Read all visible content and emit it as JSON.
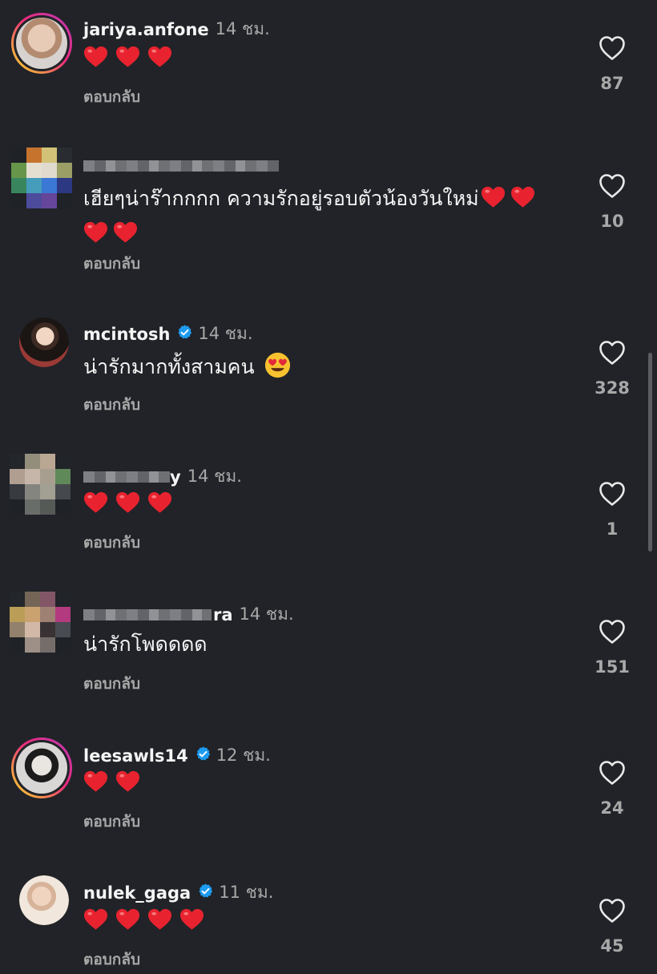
{
  "comments": [
    {
      "username": "jariya.anfone",
      "time": "14 ชม.",
      "text": "",
      "hearts": 3,
      "reply": "ตอบกลับ",
      "likes": "87",
      "verified": false
    },
    {
      "username": "",
      "time": "",
      "text": "เฮียๆน่าร๊ากกกก ความรักอยู่รอบตัวน้องวันใหม่",
      "hearts": 4,
      "reply": "ตอบกลับ",
      "likes": "10",
      "verified": false
    },
    {
      "username": "mcintosh",
      "time": "14 ชม.",
      "text": "น่ารักมากทั้งสามคน",
      "hearts": 0,
      "reply": "ตอบกลับ",
      "likes": "328",
      "verified": true
    },
    {
      "username": "y",
      "time": "14 ชม.",
      "text": "",
      "hearts": 3,
      "reply": "ตอบกลับ",
      "likes": "1",
      "verified": false
    },
    {
      "username": "ra",
      "time": "14 ชม.",
      "text": "น่ารักโพดดดด",
      "hearts": 0,
      "reply": "ตอบกลับ",
      "likes": "151",
      "verified": false
    },
    {
      "username": "leesawls14",
      "time": "12 ชม.",
      "text": "",
      "hearts": 2,
      "reply": "ตอบกลับ",
      "likes": "24",
      "verified": true
    },
    {
      "username": "nulek_gaga",
      "time": "11 ชม.",
      "text": "",
      "hearts": 4,
      "reply": "ตอบกลับ",
      "likes": "45",
      "verified": true
    }
  ],
  "icons": {
    "like": "heart-outline-icon",
    "verified": "verified-badge-icon",
    "emoji_heart": "red-heart-emoji",
    "emoji_smile": "heart-eyes-emoji"
  },
  "colors": {
    "background": "#212328",
    "text": "#f5f5f5",
    "secondary": "#a8a8a8",
    "verified": "#1d9bf0",
    "heart_emoji": "#e8232f"
  }
}
